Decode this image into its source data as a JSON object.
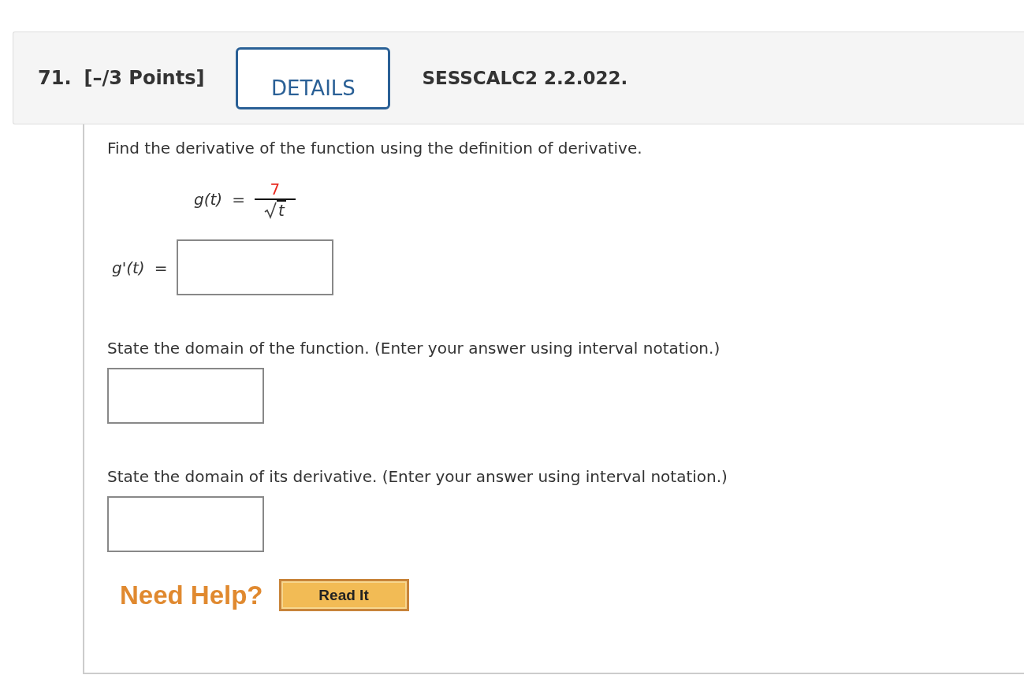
{
  "header": {
    "number": "71.",
    "points": "[–/3 Points]",
    "details_button": "DETAILS",
    "source": "SESSCALC2 2.2.022."
  },
  "question": {
    "prompt": "Find the derivative of the function using the definition of derivative.",
    "function": {
      "lhs": "g(t)",
      "equals": "=",
      "numerator": "7",
      "radicand": "t"
    },
    "derivative": {
      "label": "g'(t)",
      "equals": "="
    },
    "parts": [
      {
        "prompt": "State the domain of the function. (Enter your answer using interval notation.)"
      },
      {
        "prompt": "State the domain of its derivative. (Enter your answer using interval notation.)"
      }
    ]
  },
  "help": {
    "label": "Need Help?",
    "buttons": [
      "Read It"
    ]
  }
}
